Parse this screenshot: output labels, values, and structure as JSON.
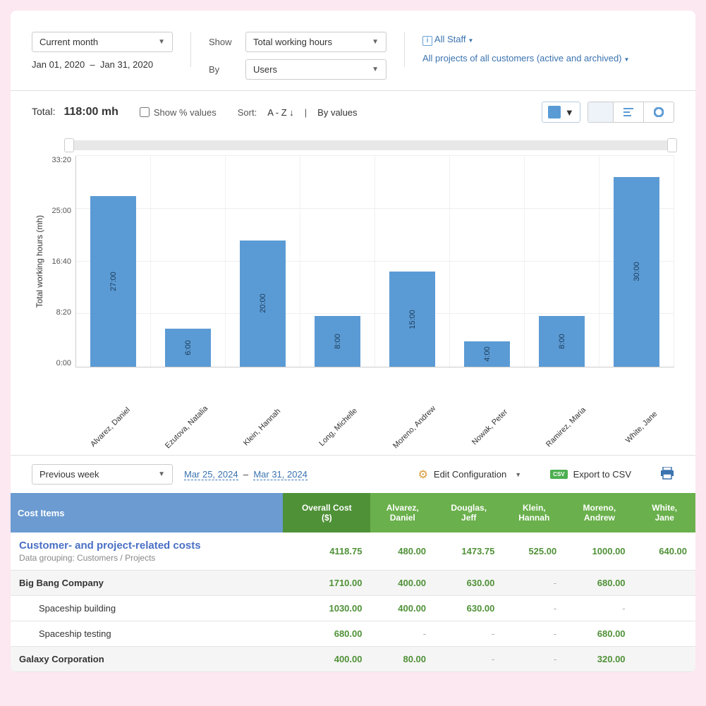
{
  "period": {
    "current": "Current month",
    "range_start": "Jan 01, 2020",
    "range_sep": "–",
    "range_end": "Jan 31, 2020"
  },
  "show": {
    "label": "Show",
    "value": "Total working hours"
  },
  "by": {
    "label": "By",
    "value": "Users"
  },
  "staff": {
    "all": "All Staff",
    "projects": "All projects of all customers (active and archived)"
  },
  "total": {
    "label": "Total:",
    "value": "118:00 mh"
  },
  "pct_checkbox": "Show % values",
  "sort": {
    "label": "Sort:",
    "opt1": "A - Z ↓",
    "opt2": "By values"
  },
  "chart_data": {
    "type": "bar",
    "ylabel": "Total working hours (mh)",
    "y_ticks": [
      "33:20",
      "25:00",
      "16:40",
      "8:20",
      "0:00"
    ],
    "max_minutes": 2000,
    "categories": [
      "Alvarez, Daniel",
      "Ezutova, Natalia",
      "Klein, Hannah",
      "Long, Michelle",
      "Moreno, Andrew",
      "Nowak, Peter",
      "Ramirez, Maria",
      "White, Jane"
    ],
    "labels": [
      "27:00",
      "6:00",
      "20:00",
      "8:00",
      "15:00",
      "4:00",
      "8:00",
      "30:00"
    ],
    "values_minutes": [
      1620,
      360,
      1200,
      480,
      900,
      240,
      480,
      1800
    ]
  },
  "lower": {
    "period": "Previous week",
    "date_start": "Mar 25, 2024",
    "sep": "–",
    "date_end": "Mar 31, 2024",
    "edit": "Edit Configuration",
    "export": "Export to CSV"
  },
  "table": {
    "header_main": "Cost Items",
    "header_overall": "Overall Cost ($)",
    "cols": [
      "Alvarez, Daniel",
      "Douglas, Jeff",
      "Klein, Hannah",
      "Moreno, Andrew",
      "White, Jane"
    ],
    "section_title": "Customer- and project-related costs",
    "section_sub": "Data grouping: Customers / Projects",
    "section_vals": [
      "4118.75",
      "480.00",
      "1473.75",
      "525.00",
      "1000.00",
      "640.00"
    ],
    "rows": [
      {
        "type": "group",
        "name": "Big Bang Company",
        "vals": [
          "1710.00",
          "400.00",
          "630.00",
          "-",
          "680.00",
          ""
        ]
      },
      {
        "type": "item",
        "name": "Spaceship building",
        "vals": [
          "1030.00",
          "400.00",
          "630.00",
          "-",
          "-",
          ""
        ]
      },
      {
        "type": "item",
        "name": "Spaceship testing",
        "vals": [
          "680.00",
          "-",
          "-",
          "-",
          "680.00",
          ""
        ]
      },
      {
        "type": "group",
        "name": "Galaxy Corporation",
        "vals": [
          "400.00",
          "80.00",
          "-",
          "-",
          "320.00",
          ""
        ]
      }
    ]
  }
}
